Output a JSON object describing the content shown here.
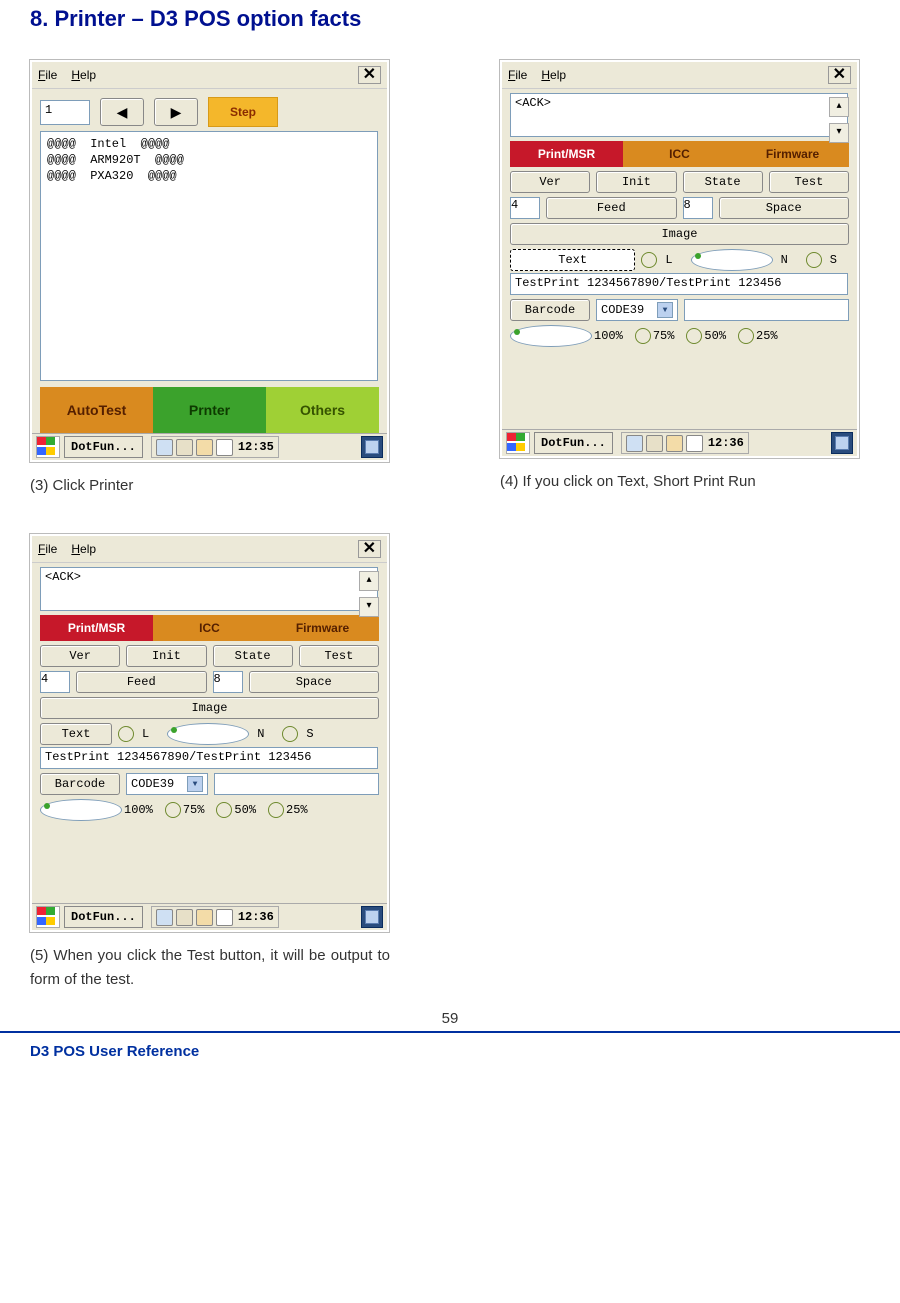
{
  "heading": "8. Printer – D3 POS option facts",
  "captions": {
    "c3": "(3) Click Printer",
    "c4": "(4) If you click on Text, Short Print Run",
    "c5": "(5)  When  you  click  the  Test button, it will be output to form of the test."
  },
  "page_number": "59",
  "footer": "D3 POS User Reference",
  "win_common": {
    "file": "File",
    "help": "Help",
    "taskapp": "DotFun...",
    "clock_a": "12:35",
    "clock_b": "12:36"
  },
  "screen1": {
    "step_num": "1",
    "step_label": "Step",
    "textarea": "@@@@  Intel  @@@@\n@@@@  ARM920T  @@@@\n@@@@  PXA320  @@@@",
    "tabs": {
      "auto": "AutoTest",
      "prn": "Prnter",
      "oth": "Others"
    }
  },
  "screen2": {
    "ack": "<ACK>",
    "tabs": {
      "pm": "Print/MSR",
      "icc": "ICC",
      "fw": "Firmware"
    },
    "ver": "Ver",
    "init": "Init",
    "state": "State",
    "test": "Test",
    "feed": "Feed",
    "space": "Space",
    "num_a": "4",
    "num_b": "8",
    "image": "Image",
    "text": "Text",
    "L": "L",
    "N": "N",
    "S": "S",
    "tp": "TestPrint 1234567890/TestPrint 123456",
    "barcode": "Barcode",
    "code": "CODE39",
    "p100": "100%",
    "p75": "75%",
    "p50": "50%",
    "p25": "25%"
  }
}
